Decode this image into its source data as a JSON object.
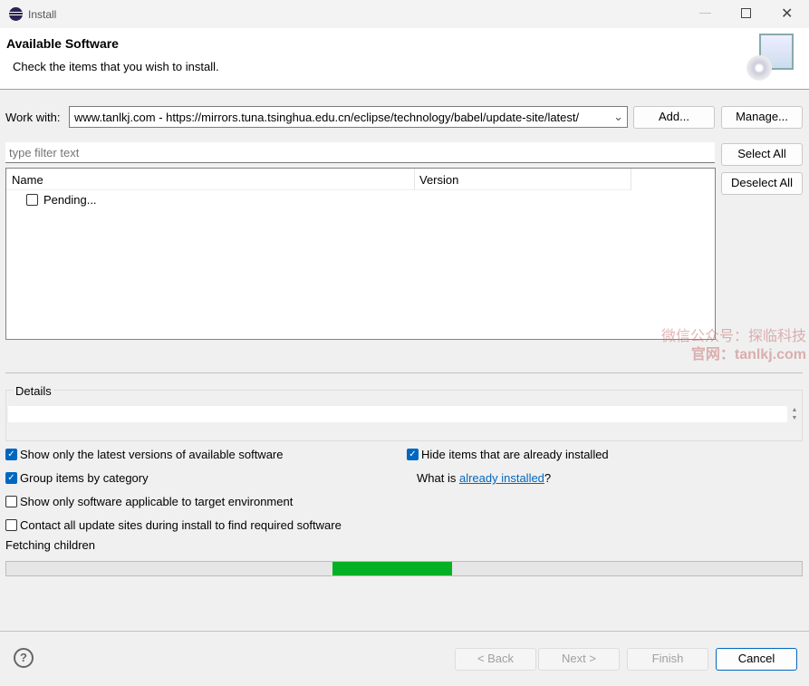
{
  "window": {
    "title": "Install"
  },
  "banner": {
    "title": "Available Software",
    "subtitle": "Check the items that you wish to install."
  },
  "work_with": {
    "label": "Work with:",
    "value": "www.tanlkj.com - https://mirrors.tuna.tsinghua.edu.cn/eclipse/technology/babel/update-site/latest/",
    "add": "Add...",
    "manage": "Manage..."
  },
  "filter": {
    "placeholder": "type filter text"
  },
  "side_buttons": {
    "select_all": "Select All",
    "deselect_all": "Deselect All"
  },
  "table": {
    "columns": [
      "Name",
      "Version"
    ],
    "rows": [
      {
        "name": "Pending...",
        "checked": false
      }
    ]
  },
  "details": {
    "label": "Details"
  },
  "options": {
    "latest": {
      "label": "Show only the latest versions of available software",
      "checked": true
    },
    "group": {
      "label": "Group items by category",
      "checked": true
    },
    "applicable": {
      "label": "Show only software applicable to target environment",
      "checked": false
    },
    "contact": {
      "label": "Contact all update sites during install to find required software",
      "checked": false
    },
    "hide": {
      "label": "Hide items that are already installed",
      "checked": true
    },
    "what_is": "What is ",
    "already_installed": "already installed",
    "q": "?"
  },
  "status": {
    "text": "Fetching children",
    "progress_segment": [
      0.41,
      0.56
    ]
  },
  "watermark": {
    "line1": "微信公众号：探临科技",
    "line2": "官网：tanlkj.com"
  },
  "footer": {
    "back": "< Back",
    "next": "Next >",
    "finish": "Finish",
    "cancel": "Cancel"
  },
  "colors": {
    "accent": "#0067c0",
    "progress": "#06b025"
  }
}
